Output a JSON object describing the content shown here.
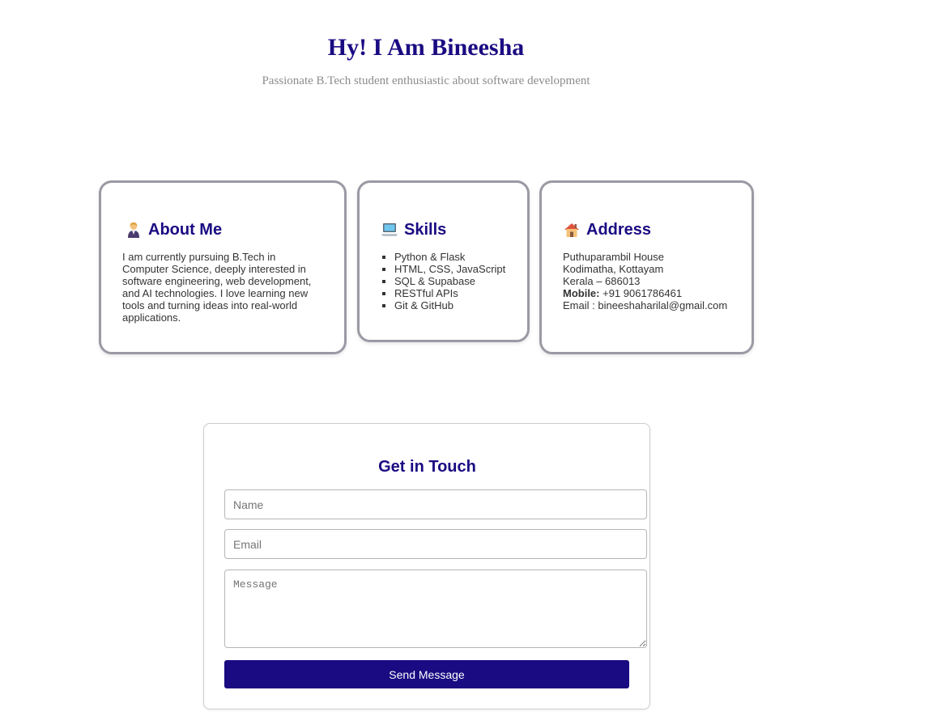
{
  "hero": {
    "title": "Hy! I Am Bineesha",
    "subtitle": "Passionate B.Tech student enthusiastic about software development"
  },
  "about": {
    "icon": "student-icon",
    "heading": "About Me",
    "text": "I am currently pursuing B.Tech in Computer Science, deeply interested in software engineering, web development, and AI technologies. I love learning new tools and turning ideas into real-world applications."
  },
  "skills": {
    "icon": "laptop-icon",
    "heading": "Skills",
    "items": [
      "Python & Flask",
      "HTML, CSS, JavaScript",
      "SQL & Supabase",
      "RESTful APIs",
      "Git & GitHub"
    ]
  },
  "address": {
    "icon": "house-icon",
    "heading": "Address",
    "line1": "Puthuparambil House",
    "line2": "Kodimatha, Kottayam",
    "line3": "Kerala – 686013",
    "mobile_label": "Mobile:",
    "mobile_value": " +91 9061786461",
    "email_line": "Email : bineeshaharilal@gmail.com"
  },
  "contact": {
    "title": "Get in Touch",
    "name_placeholder": "Name",
    "email_placeholder": "Email",
    "message_placeholder": "Message",
    "button_label": "Send Message"
  },
  "colors": {
    "accent": "#1a0b82",
    "card_border": "#9a9aa4",
    "muted_text": "#8c8c8c"
  }
}
